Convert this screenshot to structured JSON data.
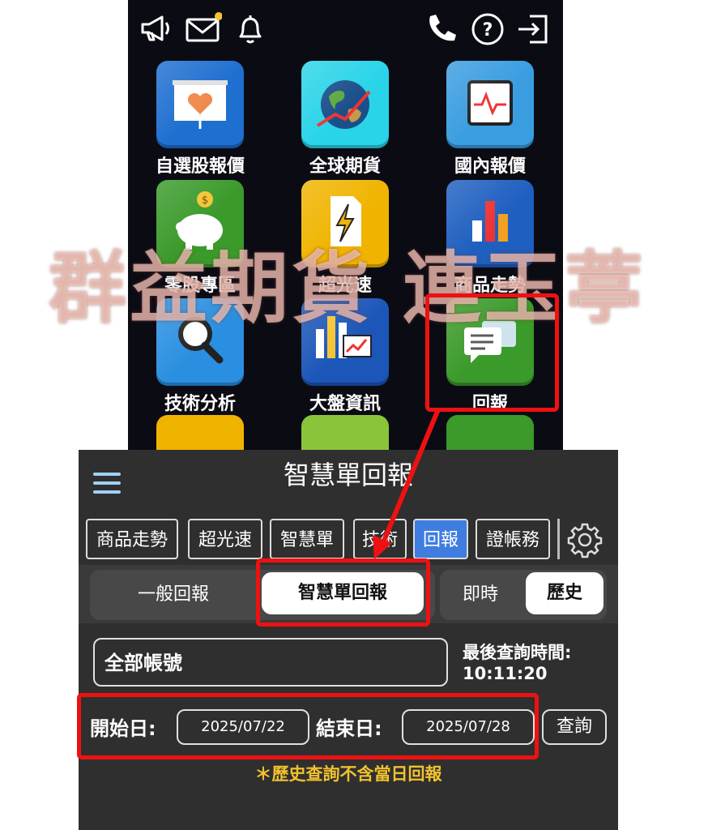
{
  "header_icons": {
    "megaphone": "megaphone-icon",
    "mail": "mail-icon",
    "bell": "bell-icon",
    "phone": "phone-icon",
    "help": "help-icon",
    "logout": "logout-icon"
  },
  "apps": [
    {
      "label": "自選股報價",
      "color": "#1e6fd0",
      "icon": "heart-chart-icon"
    },
    {
      "label": "全球期貨",
      "color": "#2ad4e8",
      "icon": "globe-icon"
    },
    {
      "label": "國內報價",
      "color": "#3a9de0",
      "icon": "pulse-icon"
    },
    {
      "label": "零股專區",
      "color": "#3a9a2a",
      "icon": "piggy-bank-icon"
    },
    {
      "label": "超光速",
      "color": "#f0b400",
      "icon": "lightning-icon"
    },
    {
      "label": "商品走勢",
      "color": "#1e5fc0",
      "icon": "bar-chart-icon"
    },
    {
      "label": "技術分析",
      "color": "#2a8fe0",
      "icon": "magnifier-icon"
    },
    {
      "label": "大盤資訊",
      "color": "#1b56b8",
      "icon": "market-chart-icon"
    },
    {
      "label": "回報",
      "color": "#3a9a2a",
      "icon": "chat-bubbles-icon"
    }
  ],
  "watermark": "群益期貨 連玉葶",
  "bottom": {
    "title": "智慧單回報",
    "tabs": [
      "商品走勢",
      "超光速",
      "智慧單",
      "技術",
      "回報",
      "證帳務"
    ],
    "segments": {
      "general": "一般回報",
      "smart": "智慧單回報",
      "realtime": "即時",
      "history": "歷史"
    },
    "account": "全部帳號",
    "last_query_label": "最後查詢時間:",
    "last_query_time": "10:11:20",
    "start_label": "開始日:",
    "start_date": "2025/07/22",
    "end_label": "結束日:",
    "end_date": "2025/07/28",
    "query_button": "查詢",
    "note": "＊歷史查詢不含當日回報"
  },
  "colors": {
    "highlight": "#ee1111",
    "active_tab": "#3f7de0",
    "note": "#f2c12e"
  }
}
